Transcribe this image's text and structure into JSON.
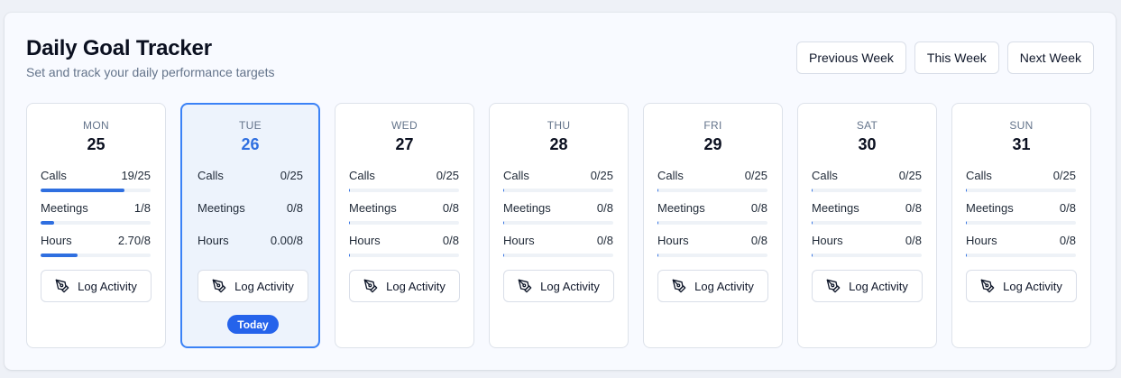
{
  "header": {
    "title": "Daily Goal Tracker",
    "subtitle": "Set and track your daily performance targets"
  },
  "nav": {
    "previous": "Previous Week",
    "current": "This Week",
    "next": "Next Week"
  },
  "log_button_label": "Log Activity",
  "log_icon": "pen-nib-icon",
  "today_badge": "Today",
  "accent_color": "#2f6fe0",
  "days": [
    {
      "name": "MON",
      "date": "25",
      "today": false,
      "metrics": [
        {
          "label": "Calls",
          "value": "19/25",
          "progress": 0.76
        },
        {
          "label": "Meetings",
          "value": "1/8",
          "progress": 0.125
        },
        {
          "label": "Hours",
          "value": "2.70/8",
          "progress": 0.3375
        }
      ]
    },
    {
      "name": "TUE",
      "date": "26",
      "today": true,
      "metrics": [
        {
          "label": "Calls",
          "value": "0/25",
          "progress": 0
        },
        {
          "label": "Meetings",
          "value": "0/8",
          "progress": 0
        },
        {
          "label": "Hours",
          "value": "0.00/8",
          "progress": 0
        }
      ]
    },
    {
      "name": "WED",
      "date": "27",
      "today": false,
      "metrics": [
        {
          "label": "Calls",
          "value": "0/25",
          "progress": 0
        },
        {
          "label": "Meetings",
          "value": "0/8",
          "progress": 0
        },
        {
          "label": "Hours",
          "value": "0/8",
          "progress": 0
        }
      ]
    },
    {
      "name": "THU",
      "date": "28",
      "today": false,
      "metrics": [
        {
          "label": "Calls",
          "value": "0/25",
          "progress": 0
        },
        {
          "label": "Meetings",
          "value": "0/8",
          "progress": 0
        },
        {
          "label": "Hours",
          "value": "0/8",
          "progress": 0
        }
      ]
    },
    {
      "name": "FRI",
      "date": "29",
      "today": false,
      "metrics": [
        {
          "label": "Calls",
          "value": "0/25",
          "progress": 0
        },
        {
          "label": "Meetings",
          "value": "0/8",
          "progress": 0
        },
        {
          "label": "Hours",
          "value": "0/8",
          "progress": 0
        }
      ]
    },
    {
      "name": "SAT",
      "date": "30",
      "today": false,
      "metrics": [
        {
          "label": "Calls",
          "value": "0/25",
          "progress": 0
        },
        {
          "label": "Meetings",
          "value": "0/8",
          "progress": 0
        },
        {
          "label": "Hours",
          "value": "0/8",
          "progress": 0
        }
      ]
    },
    {
      "name": "SUN",
      "date": "31",
      "today": false,
      "metrics": [
        {
          "label": "Calls",
          "value": "0/25",
          "progress": 0
        },
        {
          "label": "Meetings",
          "value": "0/8",
          "progress": 0
        },
        {
          "label": "Hours",
          "value": "0/8",
          "progress": 0
        }
      ]
    }
  ]
}
